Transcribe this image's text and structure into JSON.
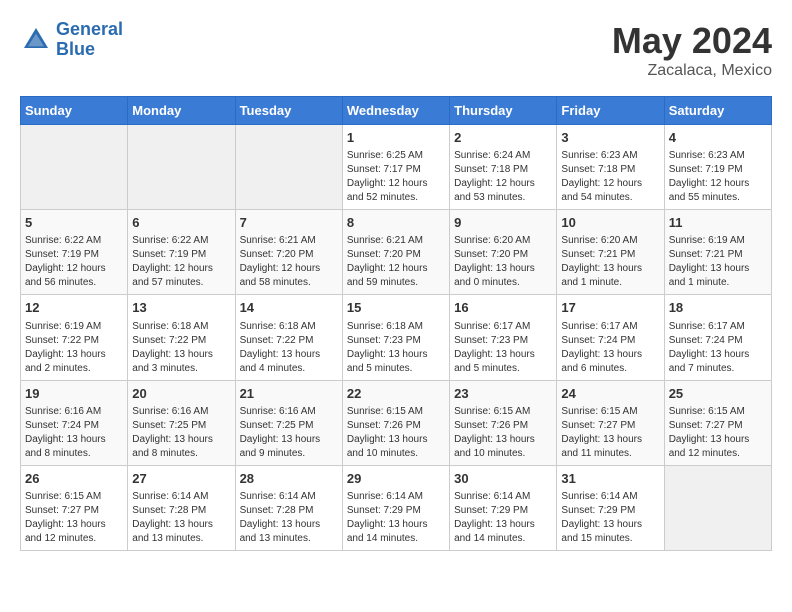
{
  "header": {
    "logo_line1": "General",
    "logo_line2": "Blue",
    "month": "May 2024",
    "location": "Zacalaca, Mexico"
  },
  "days_of_week": [
    "Sunday",
    "Monday",
    "Tuesday",
    "Wednesday",
    "Thursday",
    "Friday",
    "Saturday"
  ],
  "weeks": [
    [
      {
        "day": "",
        "info": ""
      },
      {
        "day": "",
        "info": ""
      },
      {
        "day": "",
        "info": ""
      },
      {
        "day": "1",
        "info": "Sunrise: 6:25 AM\nSunset: 7:17 PM\nDaylight: 12 hours and 52 minutes."
      },
      {
        "day": "2",
        "info": "Sunrise: 6:24 AM\nSunset: 7:18 PM\nDaylight: 12 hours and 53 minutes."
      },
      {
        "day": "3",
        "info": "Sunrise: 6:23 AM\nSunset: 7:18 PM\nDaylight: 12 hours and 54 minutes."
      },
      {
        "day": "4",
        "info": "Sunrise: 6:23 AM\nSunset: 7:19 PM\nDaylight: 12 hours and 55 minutes."
      }
    ],
    [
      {
        "day": "5",
        "info": "Sunrise: 6:22 AM\nSunset: 7:19 PM\nDaylight: 12 hours and 56 minutes."
      },
      {
        "day": "6",
        "info": "Sunrise: 6:22 AM\nSunset: 7:19 PM\nDaylight: 12 hours and 57 minutes."
      },
      {
        "day": "7",
        "info": "Sunrise: 6:21 AM\nSunset: 7:20 PM\nDaylight: 12 hours and 58 minutes."
      },
      {
        "day": "8",
        "info": "Sunrise: 6:21 AM\nSunset: 7:20 PM\nDaylight: 12 hours and 59 minutes."
      },
      {
        "day": "9",
        "info": "Sunrise: 6:20 AM\nSunset: 7:20 PM\nDaylight: 13 hours and 0 minutes."
      },
      {
        "day": "10",
        "info": "Sunrise: 6:20 AM\nSunset: 7:21 PM\nDaylight: 13 hours and 1 minute."
      },
      {
        "day": "11",
        "info": "Sunrise: 6:19 AM\nSunset: 7:21 PM\nDaylight: 13 hours and 1 minute."
      }
    ],
    [
      {
        "day": "12",
        "info": "Sunrise: 6:19 AM\nSunset: 7:22 PM\nDaylight: 13 hours and 2 minutes."
      },
      {
        "day": "13",
        "info": "Sunrise: 6:18 AM\nSunset: 7:22 PM\nDaylight: 13 hours and 3 minutes."
      },
      {
        "day": "14",
        "info": "Sunrise: 6:18 AM\nSunset: 7:22 PM\nDaylight: 13 hours and 4 minutes."
      },
      {
        "day": "15",
        "info": "Sunrise: 6:18 AM\nSunset: 7:23 PM\nDaylight: 13 hours and 5 minutes."
      },
      {
        "day": "16",
        "info": "Sunrise: 6:17 AM\nSunset: 7:23 PM\nDaylight: 13 hours and 5 minutes."
      },
      {
        "day": "17",
        "info": "Sunrise: 6:17 AM\nSunset: 7:24 PM\nDaylight: 13 hours and 6 minutes."
      },
      {
        "day": "18",
        "info": "Sunrise: 6:17 AM\nSunset: 7:24 PM\nDaylight: 13 hours and 7 minutes."
      }
    ],
    [
      {
        "day": "19",
        "info": "Sunrise: 6:16 AM\nSunset: 7:24 PM\nDaylight: 13 hours and 8 minutes."
      },
      {
        "day": "20",
        "info": "Sunrise: 6:16 AM\nSunset: 7:25 PM\nDaylight: 13 hours and 8 minutes."
      },
      {
        "day": "21",
        "info": "Sunrise: 6:16 AM\nSunset: 7:25 PM\nDaylight: 13 hours and 9 minutes."
      },
      {
        "day": "22",
        "info": "Sunrise: 6:15 AM\nSunset: 7:26 PM\nDaylight: 13 hours and 10 minutes."
      },
      {
        "day": "23",
        "info": "Sunrise: 6:15 AM\nSunset: 7:26 PM\nDaylight: 13 hours and 10 minutes."
      },
      {
        "day": "24",
        "info": "Sunrise: 6:15 AM\nSunset: 7:27 PM\nDaylight: 13 hours and 11 minutes."
      },
      {
        "day": "25",
        "info": "Sunrise: 6:15 AM\nSunset: 7:27 PM\nDaylight: 13 hours and 12 minutes."
      }
    ],
    [
      {
        "day": "26",
        "info": "Sunrise: 6:15 AM\nSunset: 7:27 PM\nDaylight: 13 hours and 12 minutes."
      },
      {
        "day": "27",
        "info": "Sunrise: 6:14 AM\nSunset: 7:28 PM\nDaylight: 13 hours and 13 minutes."
      },
      {
        "day": "28",
        "info": "Sunrise: 6:14 AM\nSunset: 7:28 PM\nDaylight: 13 hours and 13 minutes."
      },
      {
        "day": "29",
        "info": "Sunrise: 6:14 AM\nSunset: 7:29 PM\nDaylight: 13 hours and 14 minutes."
      },
      {
        "day": "30",
        "info": "Sunrise: 6:14 AM\nSunset: 7:29 PM\nDaylight: 13 hours and 14 minutes."
      },
      {
        "day": "31",
        "info": "Sunrise: 6:14 AM\nSunset: 7:29 PM\nDaylight: 13 hours and 15 minutes."
      },
      {
        "day": "",
        "info": ""
      }
    ]
  ]
}
